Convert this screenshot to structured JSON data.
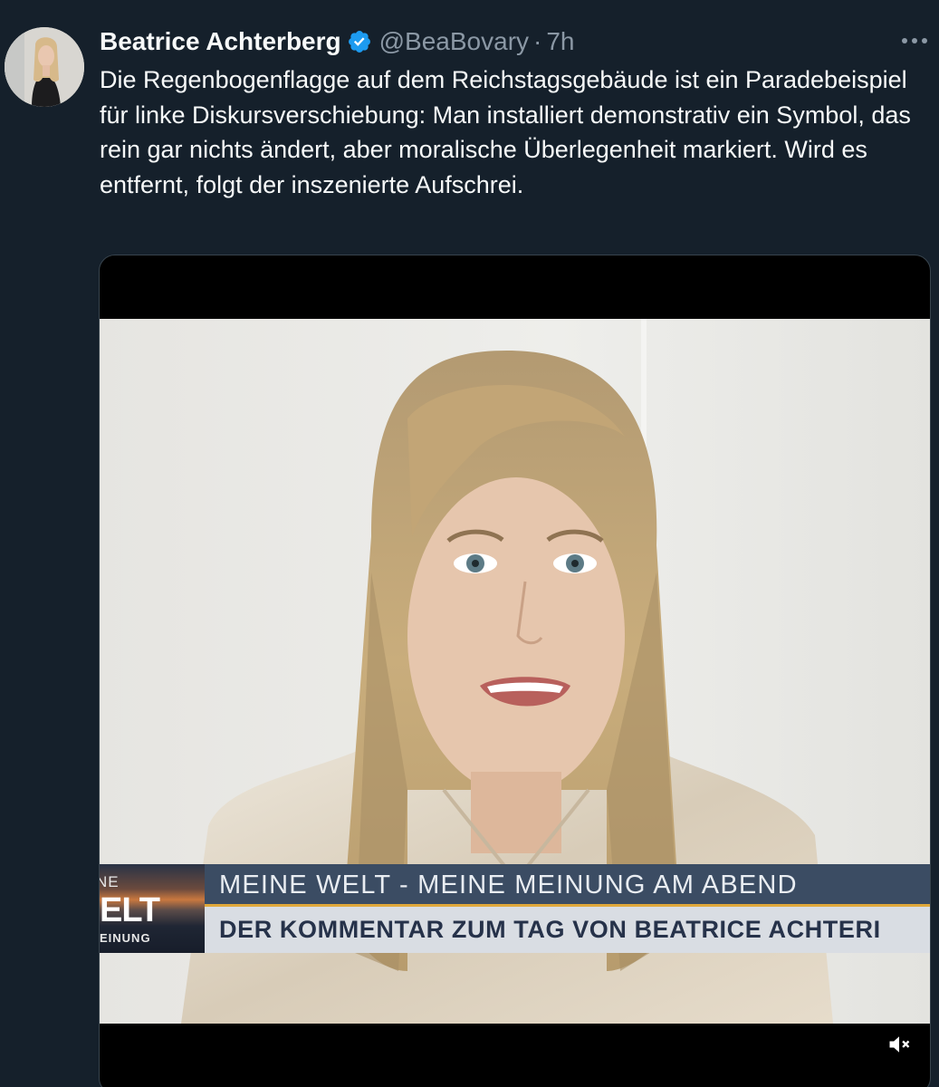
{
  "tweet": {
    "author": {
      "display_name": "Beatrice Achterberg",
      "handle": "@BeaBovary",
      "verified": true
    },
    "separator": "·",
    "time": "7h",
    "text": "Die Regenbogenflagge auf dem Reichstagsgebäude ist ein Paradebeispiel für linke Diskursverschiebung: Man installiert demonstrativ ein Symbol, das rein gar nichts ändert, aber moralische Überlegenheit markiert. Wird es entfernt, folgt der inszenierte Aufschrei."
  },
  "video": {
    "lower_third": {
      "logo_line1": "NE",
      "logo_line2": "ELT",
      "logo_line3": "EINUNG",
      "line1": "MEINE WELT - MEINE MEINUNG AM ABEND",
      "line2": "DER KOMMENTAR ZUM TAG VON BEATRICE ACHTERI"
    },
    "muted": true
  },
  "colors": {
    "background": "#15202b",
    "text_primary": "#f7f9f9",
    "text_secondary": "#8b98a5",
    "verified_badge": "#1d9bf0",
    "lower_third_bar": "#3b4c63",
    "lower_third_accent": "#e0a83a"
  },
  "icons": {
    "verified": "verified-badge-icon",
    "more": "more-horizontal-icon",
    "mute": "volume-muted-icon"
  }
}
